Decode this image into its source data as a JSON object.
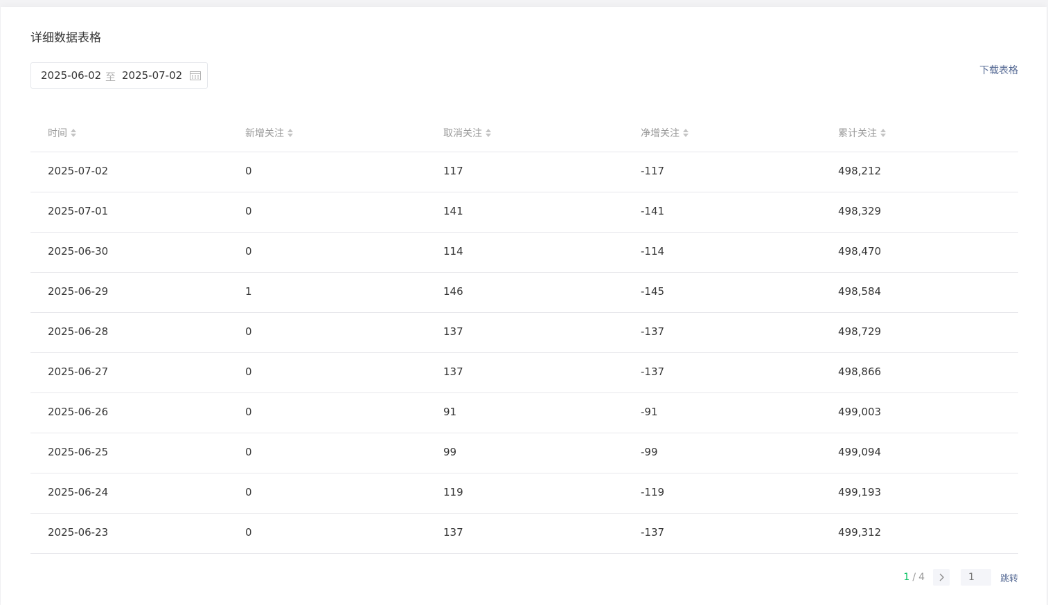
{
  "section": {
    "title": "详细数据表格",
    "download_label": "下载表格"
  },
  "date_range": {
    "start": "2025-06-02",
    "separator": "至",
    "end": "2025-07-02"
  },
  "table": {
    "headers": [
      "时间",
      "新增关注",
      "取消关注",
      "净增关注",
      "累计关注"
    ],
    "rows": [
      [
        "2025-07-02",
        "0",
        "117",
        "-117",
        "498,212"
      ],
      [
        "2025-07-01",
        "0",
        "141",
        "-141",
        "498,329"
      ],
      [
        "2025-06-30",
        "0",
        "114",
        "-114",
        "498,470"
      ],
      [
        "2025-06-29",
        "1",
        "146",
        "-145",
        "498,584"
      ],
      [
        "2025-06-28",
        "0",
        "137",
        "-137",
        "498,729"
      ],
      [
        "2025-06-27",
        "0",
        "137",
        "-137",
        "498,866"
      ],
      [
        "2025-06-26",
        "0",
        "91",
        "-91",
        "499,003"
      ],
      [
        "2025-06-25",
        "0",
        "99",
        "-99",
        "499,094"
      ],
      [
        "2025-06-24",
        "0",
        "119",
        "-119",
        "499,193"
      ],
      [
        "2025-06-23",
        "0",
        "137",
        "-137",
        "499,312"
      ]
    ]
  },
  "pagination": {
    "current": "1",
    "separator": "/",
    "total": "4",
    "input_placeholder": "1",
    "jump_label": "跳转"
  },
  "colors": {
    "accent_green": "#07c160",
    "link_blue": "#576b95",
    "text_primary": "#353535",
    "text_secondary": "#9a9a9a"
  }
}
